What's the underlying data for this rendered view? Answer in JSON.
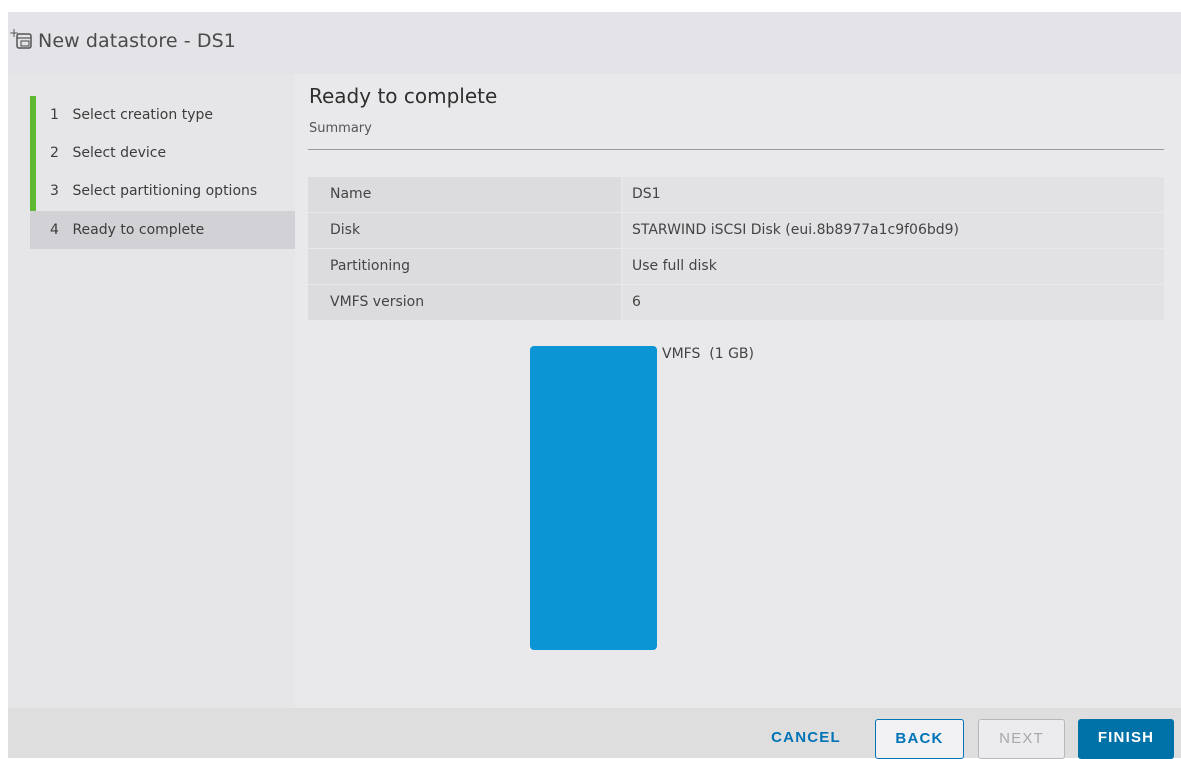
{
  "window": {
    "title": "New datastore - DS1",
    "icon": "new-datastore-icon"
  },
  "steps": [
    {
      "num": "1",
      "label": "Select creation type"
    },
    {
      "num": "2",
      "label": "Select device"
    },
    {
      "num": "3",
      "label": "Select partitioning options"
    },
    {
      "num": "4",
      "label": "Ready to complete",
      "active": true
    }
  ],
  "main": {
    "title": "Ready to complete",
    "subtitle": "Summary",
    "summary": [
      {
        "label": "Name",
        "value": "DS1"
      },
      {
        "label": "Disk",
        "value": "STARWIND iSCSI Disk (eui.8b8977a1c9f06bd9)"
      },
      {
        "label": "Partitioning",
        "value": "Use full disk"
      },
      {
        "label": "VMFS version",
        "value": "6"
      }
    ],
    "partition_label": "VMFS  (1 GB)",
    "partition_color": "#0b95d5"
  },
  "footer": {
    "cancel": "CANCEL",
    "back": "BACK",
    "next": "NEXT",
    "finish": "FINISH"
  },
  "colors": {
    "accent": "#0074b6",
    "step_progress": "#5fb832"
  }
}
